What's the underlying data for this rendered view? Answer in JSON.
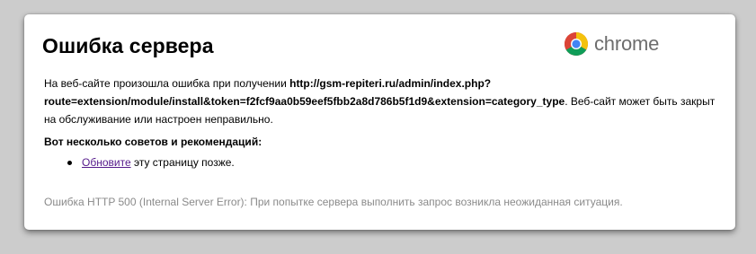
{
  "page": {
    "title": "Ошибка сервера",
    "brand": "chrome"
  },
  "message": {
    "prefix": "На веб-сайте произошла ошибка при получении ",
    "url_line1": "http://gsm-repiteri.ru/admin/index.php?",
    "url_line2": "route=extension/module/install&token=f2fcf9aa0b59eef5fbb2a8d786b5f1d9&extension=category_type",
    "suffix": ". Веб-сайт может быть закрыт на обслуживание или настроен неправильно."
  },
  "tips": {
    "heading": "Вот несколько советов и рекомендаций:",
    "items": [
      {
        "link": "Обновите",
        "text": " эту страницу позже."
      }
    ]
  },
  "footer": {
    "error_text": "Ошибка HTTP 500 (Internal Server Error): При попытке сервера выполнить запрос возникла неожиданная ситуация."
  },
  "colors": {
    "background": "#cccccc",
    "card": "#ffffff",
    "link_visited": "#551a8b",
    "footer_text": "#8a8a8a",
    "brand_text": "#6d6d6d"
  }
}
